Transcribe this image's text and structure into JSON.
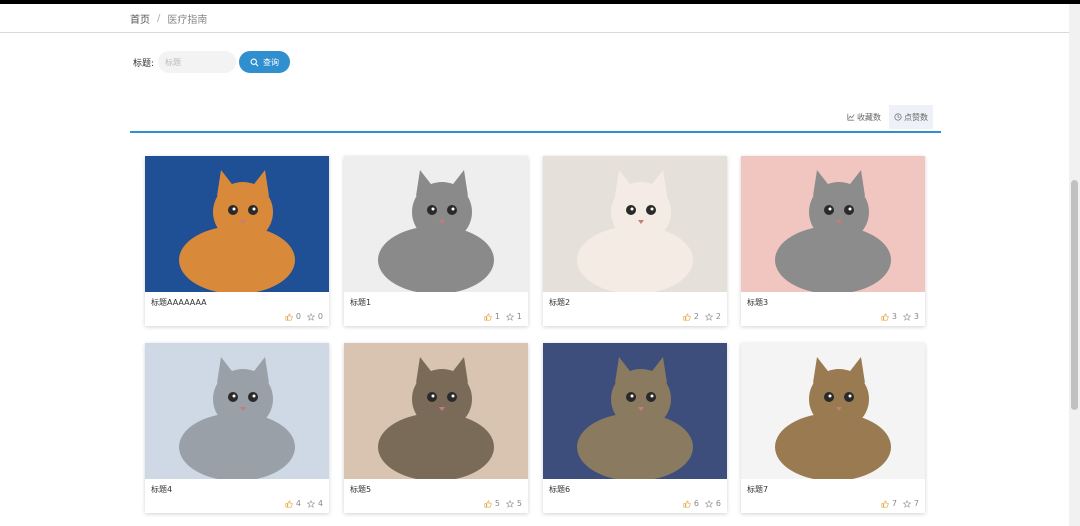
{
  "breadcrumb": {
    "home": "首页",
    "separator": "/",
    "current": "医疗指南"
  },
  "search": {
    "label": "标题:",
    "placeholder": "标题",
    "value": "",
    "button_label": "查询"
  },
  "sort": {
    "favorites_label": "收藏数",
    "likes_label": "点赞数"
  },
  "cards": [
    {
      "title": "标题AAAAAAA",
      "likes": "0",
      "favorites": "0",
      "bg": "#1f4f94",
      "cat": "#d88a3a"
    },
    {
      "title": "标题1",
      "likes": "1",
      "favorites": "1",
      "bg": "#eeeeee",
      "cat": "#8a8a8a"
    },
    {
      "title": "标题2",
      "likes": "2",
      "favorites": "2",
      "bg": "#e6e0da",
      "cat": "#f4ece4"
    },
    {
      "title": "标题3",
      "likes": "3",
      "favorites": "3",
      "bg": "#f2c6c0",
      "cat": "#8c8c8c"
    },
    {
      "title": "标题4",
      "likes": "4",
      "favorites": "4",
      "bg": "#cfd9e6",
      "cat": "#9aa0a8"
    },
    {
      "title": "标题5",
      "likes": "5",
      "favorites": "5",
      "bg": "#d8c4b0",
      "cat": "#7a6a58"
    },
    {
      "title": "标题6",
      "likes": "6",
      "favorites": "6",
      "bg": "#3e4e7c",
      "cat": "#8a7a60"
    },
    {
      "title": "标题7",
      "likes": "7",
      "favorites": "7",
      "bg": "#f4f4f4",
      "cat": "#9a7a50"
    }
  ],
  "colors": {
    "accent": "#2f8fcf",
    "like": "#e6a23c"
  }
}
